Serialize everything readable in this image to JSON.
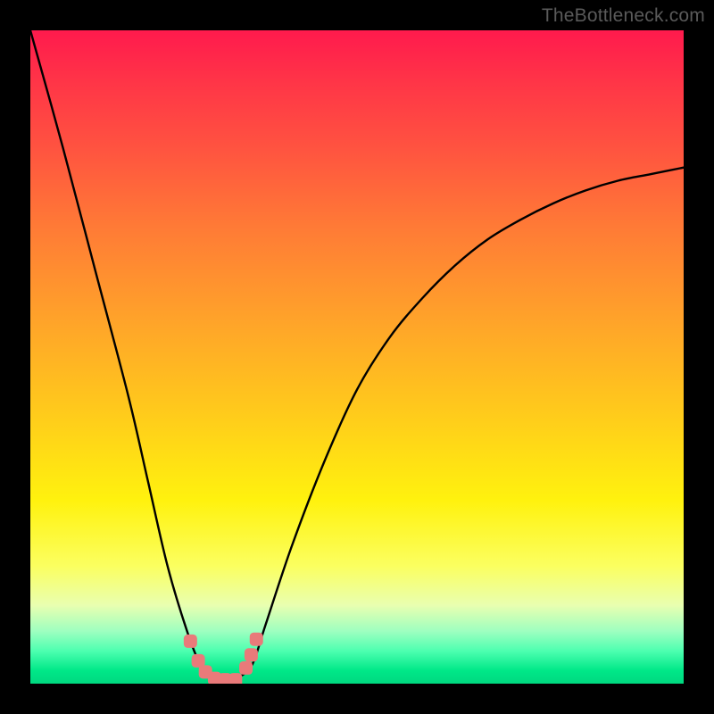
{
  "watermark": "TheBottleneck.com",
  "chart_data": {
    "type": "line",
    "title": "",
    "xlabel": "",
    "ylabel": "",
    "xlim": [
      0,
      100
    ],
    "ylim": [
      0,
      100
    ],
    "series": [
      {
        "name": "bottleneck-curve",
        "x": [
          0,
          5,
          10,
          15,
          18,
          21,
          24,
          26,
          28,
          30,
          32,
          34,
          36,
          40,
          45,
          50,
          55,
          60,
          65,
          70,
          75,
          80,
          85,
          90,
          95,
          100
        ],
        "values": [
          100,
          82,
          63,
          44,
          31,
          18,
          8,
          3,
          1,
          0,
          1,
          3,
          9,
          21,
          34,
          45,
          53,
          59,
          64,
          68,
          71,
          73.5,
          75.5,
          77,
          78,
          79
        ]
      }
    ],
    "markers": {
      "name": "highlight-dots",
      "color": "#e97a7a",
      "points": [
        {
          "x": 24.5,
          "y": 6.5
        },
        {
          "x": 25.7,
          "y": 3.5
        },
        {
          "x": 26.8,
          "y": 1.8
        },
        {
          "x": 28.2,
          "y": 0.8
        },
        {
          "x": 29.8,
          "y": 0.6
        },
        {
          "x": 31.4,
          "y": 0.6
        },
        {
          "x": 33.0,
          "y": 2.4
        },
        {
          "x": 33.8,
          "y": 4.4
        },
        {
          "x": 34.6,
          "y": 6.8
        }
      ]
    },
    "gradient_meaning": "red=high bottleneck, green=low bottleneck"
  }
}
